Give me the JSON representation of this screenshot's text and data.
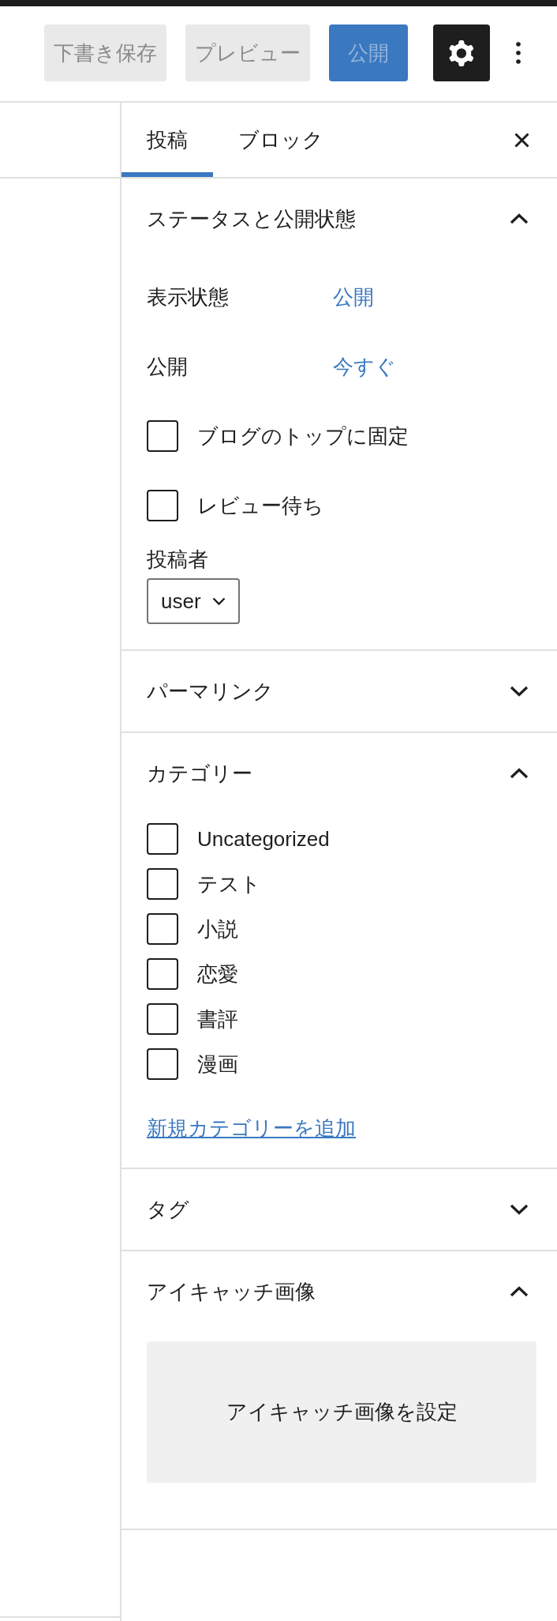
{
  "header": {
    "buttons": [
      {
        "label": "下書き保存",
        "kind": "secondary",
        "disabled": true
      },
      {
        "label": "プレビュー",
        "kind": "secondary",
        "disabled": true
      },
      {
        "label": "公開",
        "kind": "primary",
        "disabled": true
      }
    ],
    "settings_toggle": {
      "pressed": true
    }
  },
  "sidebar": {
    "tabs": [
      {
        "label": "投稿",
        "selected": true
      },
      {
        "label": "ブロック",
        "selected": false
      }
    ],
    "sections": [
      {
        "title": "ステータスと公開状態",
        "expanded": true,
        "kind": "status",
        "rows": [
          {
            "label": "表示状態",
            "value": "公開"
          },
          {
            "label": "公開",
            "value": "今すぐ"
          }
        ],
        "options": [
          {
            "label": "ブログのトップに固定",
            "checked": false
          },
          {
            "label": "レビュー待ち",
            "checked": false
          }
        ],
        "author": {
          "label": "投稿者",
          "value": "user"
        }
      },
      {
        "title": "パーマリンク",
        "expanded": false
      },
      {
        "title": "カテゴリー",
        "expanded": true,
        "kind": "categories",
        "items": [
          {
            "label": "Uncategorized",
            "checked": false
          },
          {
            "label": "テスト",
            "checked": false
          },
          {
            "label": "小説",
            "checked": false
          },
          {
            "label": "恋愛",
            "checked": false
          },
          {
            "label": "書評",
            "checked": false
          },
          {
            "label": "漫画",
            "checked": false
          }
        ],
        "add_link": "新規カテゴリーを追加"
      },
      {
        "title": "タグ",
        "expanded": false
      },
      {
        "title": "アイキャッチ画像",
        "expanded": true,
        "kind": "featured_image",
        "button": "アイキャッチ画像を設定"
      }
    ]
  }
}
